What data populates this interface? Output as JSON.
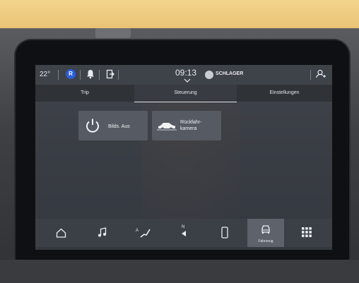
{
  "status_bar": {
    "temperature": "22°",
    "profile_initial": "R",
    "time": "09:13",
    "radio_station": "SCHLAGER"
  },
  "tabs": [
    {
      "label": "Trip",
      "active": false
    },
    {
      "label": "Steuerung",
      "active": true
    },
    {
      "label": "Einstellungen",
      "active": false
    }
  ],
  "tiles": [
    {
      "label": "Bilds. Aus",
      "icon": "power-icon"
    },
    {
      "label": "Rückfahr-kamera",
      "line1": "Rückfahr-",
      "line2": "kamera",
      "icon": "rear-camera-car-icon"
    }
  ],
  "nav": [
    {
      "icon": "home-icon",
      "label": ""
    },
    {
      "icon": "music-note-icon",
      "label": ""
    },
    {
      "icon": "navigation-route-icon",
      "label": ""
    },
    {
      "icon": "compass-north-icon",
      "label": ""
    },
    {
      "icon": "phone-icon",
      "label": ""
    },
    {
      "icon": "vehicle-icon",
      "label": "Fahrzeug",
      "active": true
    },
    {
      "icon": "apps-grid-icon",
      "label": ""
    }
  ],
  "colors": {
    "accent_profile": "#2c5ed8",
    "screen_bg": "#393d44",
    "tile_bg": "#555a63",
    "active_nav_bg": "#5d626b"
  }
}
